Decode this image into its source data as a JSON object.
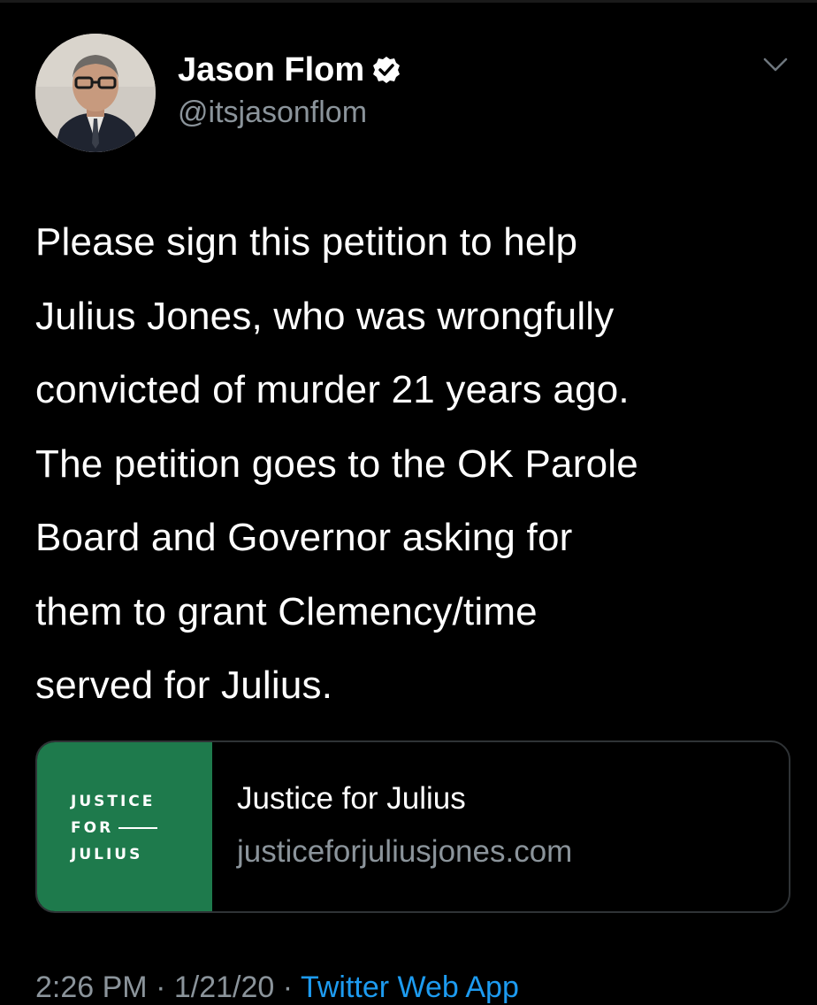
{
  "tweet": {
    "author": {
      "display_name": "Jason Flom",
      "handle": "@itsjasonflom",
      "verified_icon": "verified-badge-icon",
      "avatar_icon": "profile-photo"
    },
    "menu_icon": "chevron-down-icon",
    "text_lines": [
      "Please sign this petition to help",
      "Julius Jones, who was wrongfully",
      "convicted of murder 21 years ago.",
      "The petition goes to the OK Parole",
      "Board and Governor asking for",
      "them to grant Clemency/time",
      "served for Julius."
    ],
    "link_card": {
      "logo_lines": [
        "JUSTICE",
        "FOR",
        "JULIUS"
      ],
      "title": "Justice for Julius",
      "domain": "justiceforjuliusjones.com",
      "thumb_color": "#1e7a4c"
    },
    "meta": {
      "time": "2:26 PM",
      "separator": "·",
      "date": "1/21/20",
      "separator2": "·",
      "source": "Twitter Web App"
    }
  },
  "colors": {
    "background": "#000000",
    "primary_text": "#ffffff",
    "secondary_text": "#8b949b",
    "link_blue": "#1d9bf0",
    "border": "#2f3336"
  }
}
